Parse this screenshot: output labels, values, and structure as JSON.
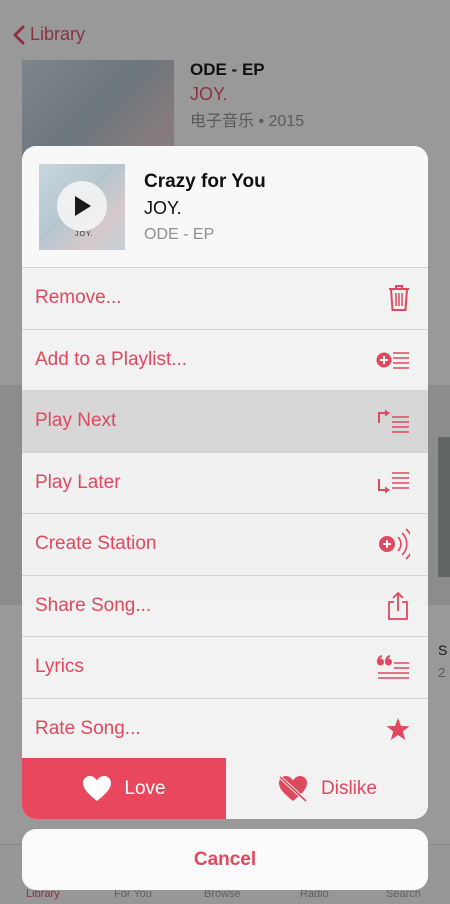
{
  "background": {
    "back_label": "Library",
    "album": {
      "title": "ODE - EP",
      "artist": "JOY.",
      "meta": "电子音乐 • 2015"
    },
    "side_text": "S",
    "side_num": "2",
    "tabs": [
      "Library",
      "For You",
      "Browse",
      "Radio",
      "Search"
    ]
  },
  "song": {
    "title": "Crazy for You",
    "artist": "JOY.",
    "album": "ODE - EP",
    "art_text": "JOY."
  },
  "menu": [
    {
      "label": "Remove...",
      "icon": "trash-icon"
    },
    {
      "label": "Add to a Playlist...",
      "icon": "add-to-playlist-icon"
    },
    {
      "label": "Play Next",
      "icon": "play-next-icon"
    },
    {
      "label": "Play Later",
      "icon": "play-later-icon"
    },
    {
      "label": "Create Station",
      "icon": "station-icon"
    },
    {
      "label": "Share Song...",
      "icon": "share-icon"
    },
    {
      "label": "Lyrics",
      "icon": "lyrics-icon"
    },
    {
      "label": "Rate Song...",
      "icon": "star-icon"
    }
  ],
  "love_label": "Love",
  "dislike_label": "Dislike",
  "cancel_label": "Cancel",
  "colors": {
    "accent": "#e0485e",
    "love_bg": "#e9475d"
  }
}
